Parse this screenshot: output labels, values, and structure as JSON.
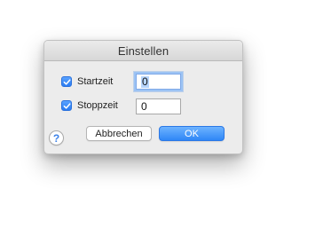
{
  "dialog": {
    "title": "Einstellen",
    "help_label": "?",
    "fields": {
      "start": {
        "label": "Startzeit",
        "checked": true,
        "value": "0",
        "focused": true
      },
      "stop": {
        "label": "Stoppzeit",
        "checked": true,
        "value": "0",
        "focused": false
      }
    },
    "buttons": {
      "cancel": "Abbrechen",
      "ok": "OK"
    },
    "icons": {
      "checkbox": "checkmark-icon",
      "help": "help-icon"
    },
    "colors": {
      "accent": "#2f86f6",
      "selection": "#b6d4fb",
      "background": "#ececec"
    }
  }
}
